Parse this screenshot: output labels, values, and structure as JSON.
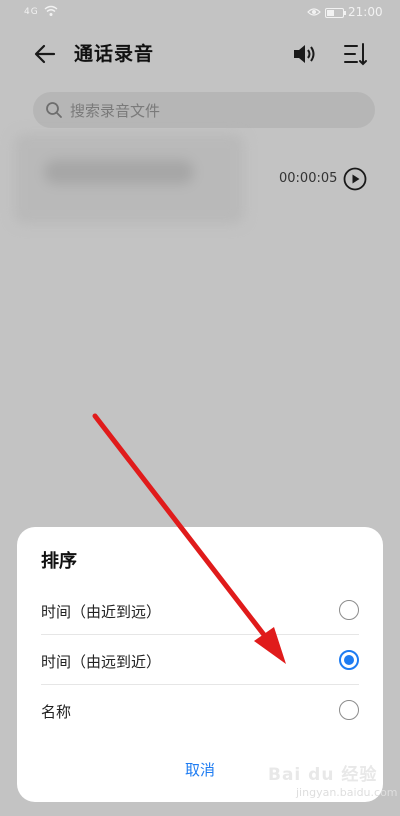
{
  "status_bar": {
    "time": "21:00",
    "signal": "4G",
    "battery_level": 0.4
  },
  "header": {
    "title": "通话录音",
    "icons": {
      "back": "arrow-left-icon",
      "speaker": "speaker-icon",
      "sort": "sort-icon"
    }
  },
  "search": {
    "placeholder": "搜索录音文件",
    "icon": "search-icon"
  },
  "recordings": [
    {
      "duration": "00:00:05"
    }
  ],
  "sort_sheet": {
    "title": "排序",
    "options": [
      {
        "label": "时间（由近到远）",
        "selected": false
      },
      {
        "label": "时间（由远到近）",
        "selected": true
      },
      {
        "label": "名称",
        "selected": false
      }
    ],
    "cancel_label": "取消"
  },
  "watermark": {
    "text": "Bai du 经验",
    "sub": "jingyan.baidu.com"
  },
  "colors": {
    "accent": "#1e7cf2",
    "arrow": "#e01b1b",
    "dim_bg": "#c3c3c3"
  }
}
